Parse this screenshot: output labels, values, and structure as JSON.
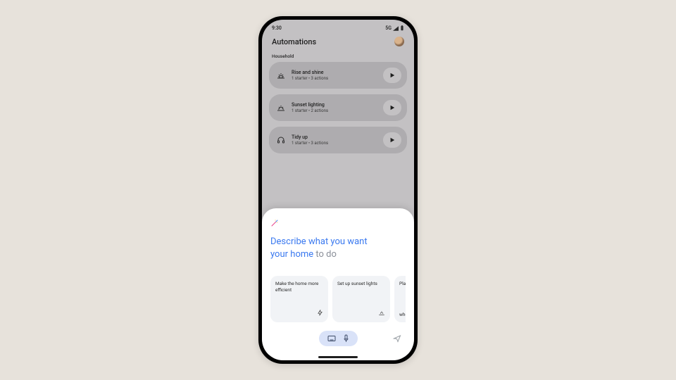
{
  "status": {
    "time": "9:30",
    "network": "5G"
  },
  "page": {
    "title": "Automations",
    "section": "Household"
  },
  "automations": [
    {
      "icon": "sunrise",
      "title": "Rise and shine",
      "sub": "1 starter • 3 actions"
    },
    {
      "icon": "sunset",
      "title": "Sunset lighting",
      "sub": "1 starter • 2 actions"
    },
    {
      "icon": "tidy",
      "title": "Tidy up",
      "sub": "1 starter • 3 actions"
    }
  ],
  "sheet": {
    "prompt": {
      "w1": "Describe ",
      "w2": "what ",
      "w3": "you ",
      "w4": "want ",
      "w5": "your ",
      "w6": "home ",
      "w7": "to ",
      "w8": "do"
    },
    "suggestions": [
      {
        "text": "Make the home more efficient",
        "icon": "bolt"
      },
      {
        "text": "Set up sunset lights",
        "icon": "sunset"
      },
      {
        "text": "Play",
        "text2": "when",
        "icon": ""
      }
    ]
  }
}
